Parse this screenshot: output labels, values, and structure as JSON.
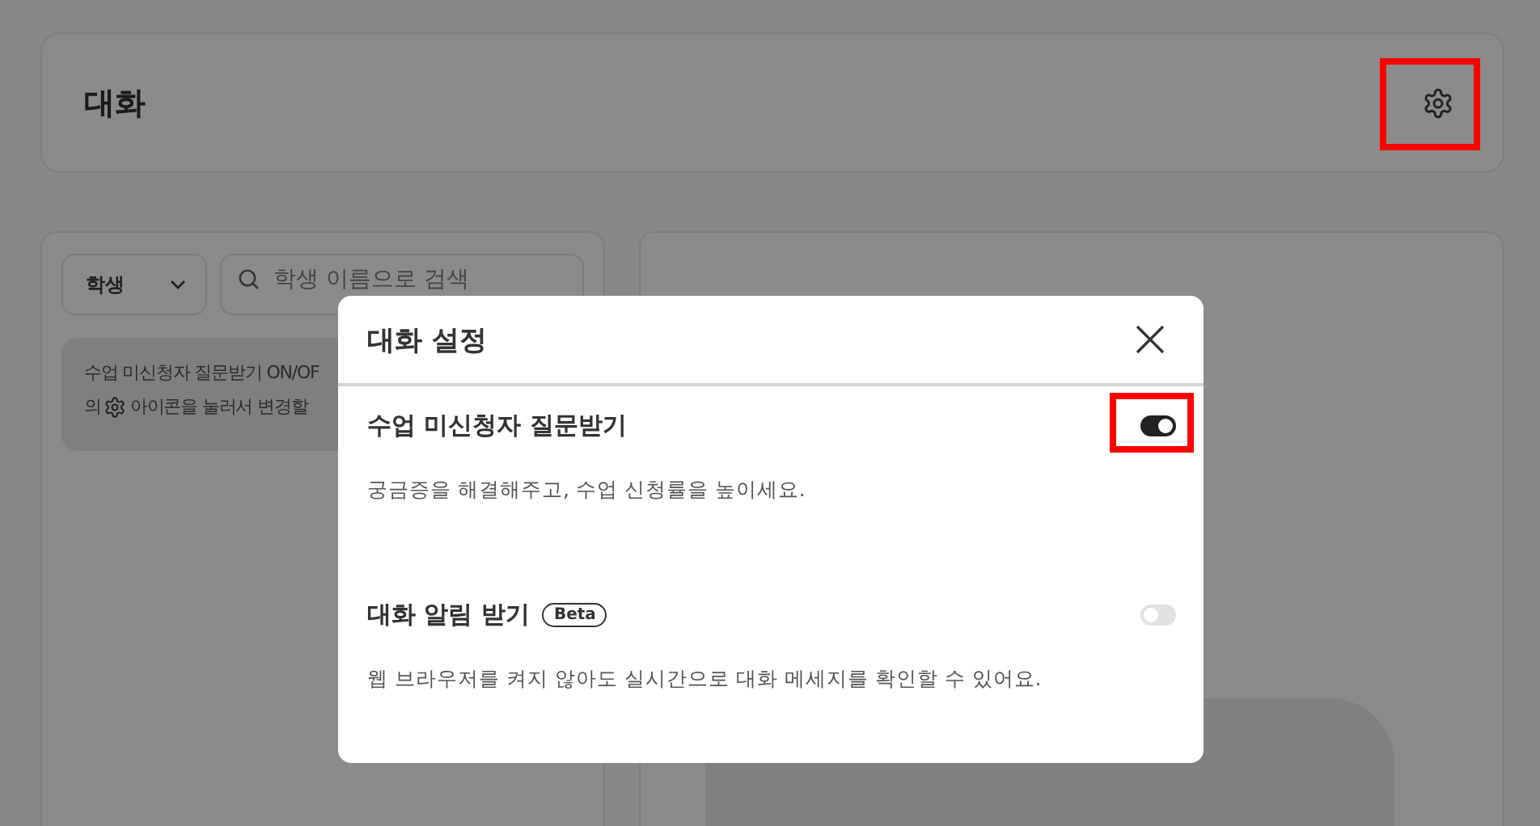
{
  "header": {
    "title": "대화",
    "highlighted": true
  },
  "filter": {
    "select": "학생",
    "search_placeholder": "학생 이름으로 검색"
  },
  "notice": {
    "line_1": "수업 미신청자 질문받기 ON/OF",
    "line_2_before": "의",
    "line_2_after": "아이콘을 눌러서 변경할"
  },
  "dialog": {
    "title": "대화 설정",
    "settings": [
      {
        "title": "수업 미신청자 질문받기",
        "description": "궁금증을 해결해주고, 수업 신청률을 높이세요.",
        "on": true,
        "highlighted": true
      },
      {
        "title": "대화 알림 받기",
        "badge": "Beta",
        "description": "웹 브라우저를 켜지 않아도 실시간으로 대화 메세지를 확인할 수 있어요.",
        "on": false,
        "highlighted": false
      }
    ]
  }
}
